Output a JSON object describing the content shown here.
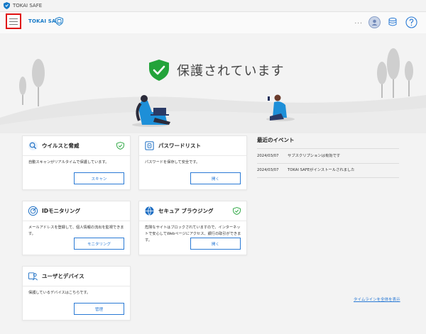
{
  "window": {
    "title": "TOKAI SAFE"
  },
  "header": {
    "brand": "TOKAI SAFE",
    "more": "..."
  },
  "status": {
    "text": "保護されています"
  },
  "cards": [
    {
      "title": "ウイルスと脅威",
      "desc": "自動スキャンがリアルタイムで保護しています。",
      "button": "スキャン"
    },
    {
      "title": "パスワードリスト",
      "desc": "パスワードを保存して安全です。",
      "button": "開く"
    },
    {
      "title": "IDモニタリング",
      "desc": "メールアドレスを登録して、個人情報の流出を監視できます。",
      "button": "モニタリング"
    },
    {
      "title": "セキュア ブラウジング",
      "desc": "危険なサイトはブロックされていますので、インターネットで安心してWebページにアクセス、銀行の取引ができます。",
      "button": "開く"
    },
    {
      "title": "ユーザとデバイス",
      "desc": "保護しているデバイスはこちらです。",
      "button": "管理"
    }
  ],
  "events": {
    "title": "最近のイベント",
    "items": [
      {
        "date": "2024/03/07",
        "text": "サブスクリプションは有効です"
      },
      {
        "date": "2024/03/07",
        "text": "TOKAI SAFEがインストールされました"
      }
    ],
    "timeline_link": "タイムラインを全体を表示"
  },
  "colors": {
    "accent": "#2a7ad5",
    "brand": "#1579c7",
    "protected": "#23a33a",
    "highlight": "#e01010"
  }
}
